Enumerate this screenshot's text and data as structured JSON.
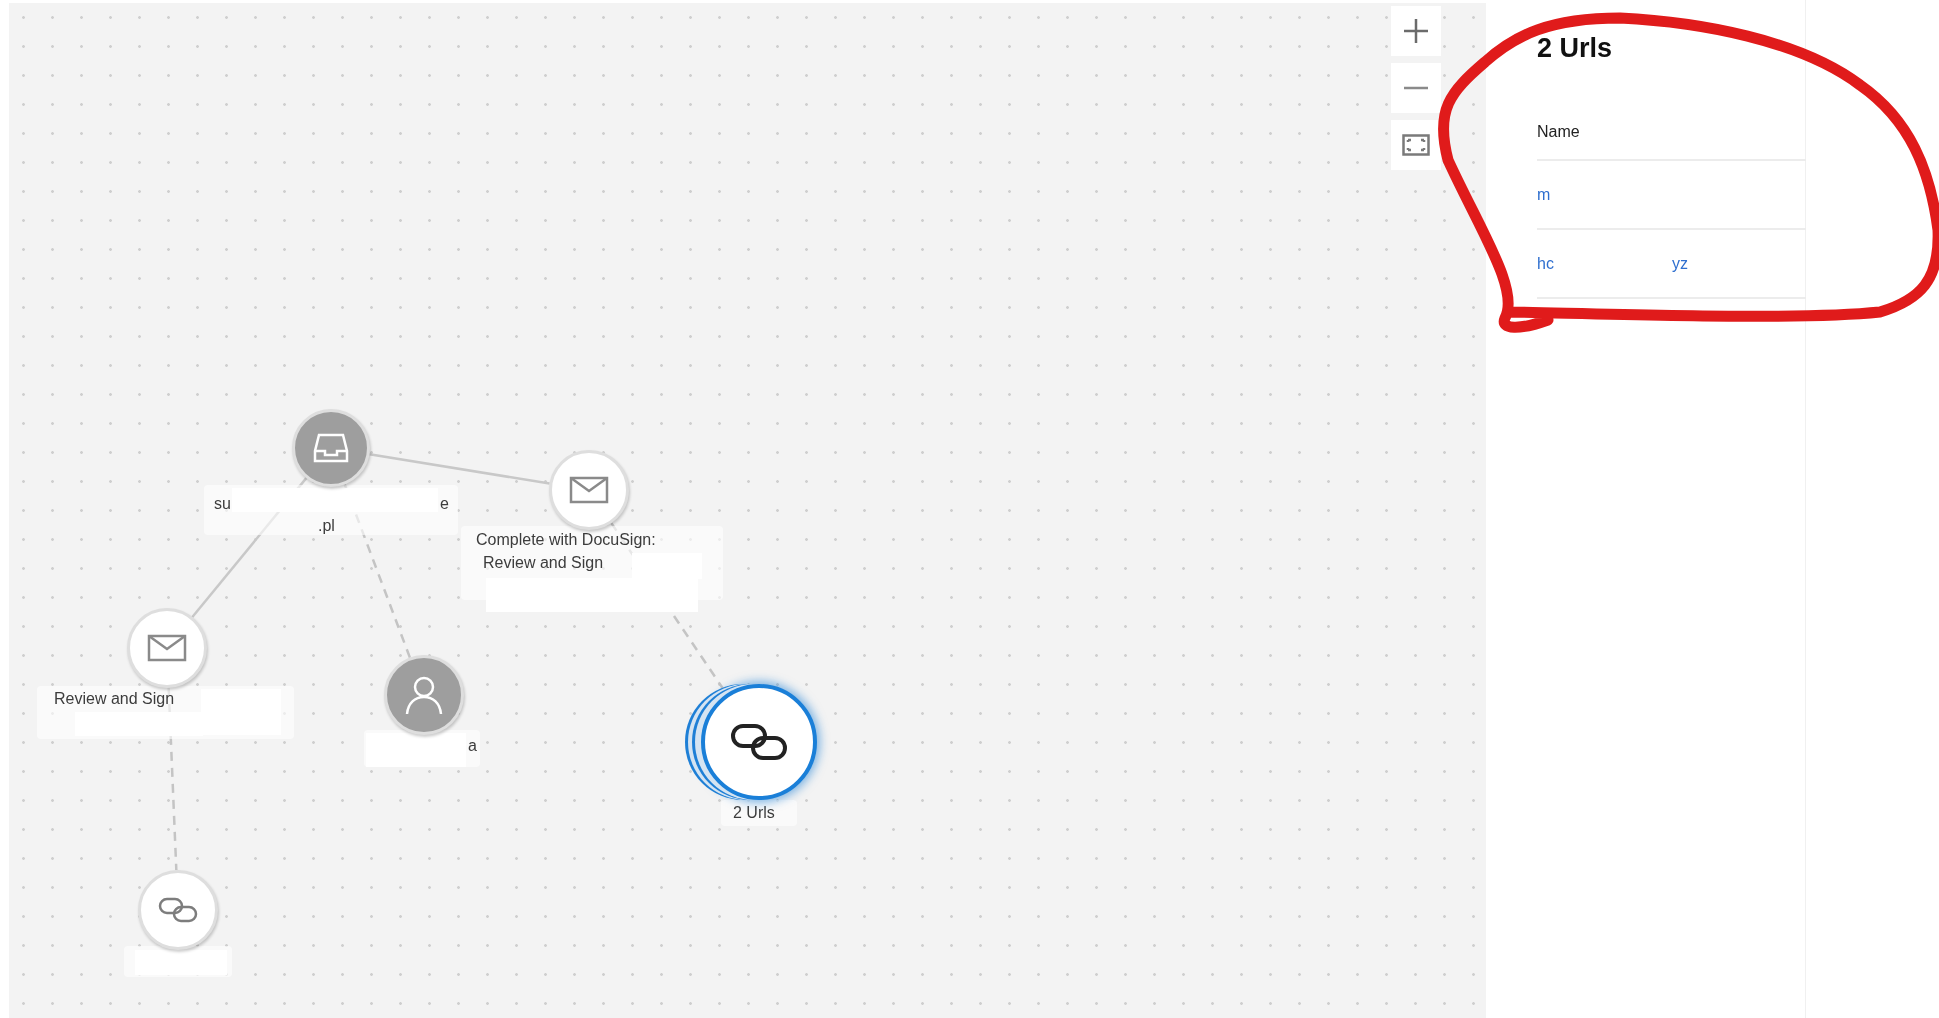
{
  "zoom_controls": [
    {
      "kind": "zoom_in"
    },
    {
      "kind": "zoom_out"
    },
    {
      "kind": "fit"
    }
  ],
  "graph": {
    "nodes": [
      {
        "kind": "inbox",
        "selected": false,
        "texts": [
          "su",
          "e",
          ".pl"
        ]
      },
      {
        "kind": "mail",
        "selected": false,
        "texts": [
          "Complete with DocuSign:",
          "Review and Sign"
        ]
      },
      {
        "kind": "mail",
        "selected": false,
        "texts": [
          "Review and Sign"
        ]
      },
      {
        "kind": "person",
        "selected": false,
        "texts": [
          "a"
        ]
      },
      {
        "kind": "link_group",
        "selected": true,
        "texts": [
          "2 Urls"
        ]
      },
      {
        "kind": "link",
        "selected": false
      }
    ]
  },
  "details": {
    "title": "2 Urls",
    "table": {
      "columns": [
        "Name"
      ],
      "rows": [
        {
          "name": [
            "m"
          ]
        },
        {
          "name": [
            "hc",
            "yz"
          ]
        }
      ]
    }
  }
}
